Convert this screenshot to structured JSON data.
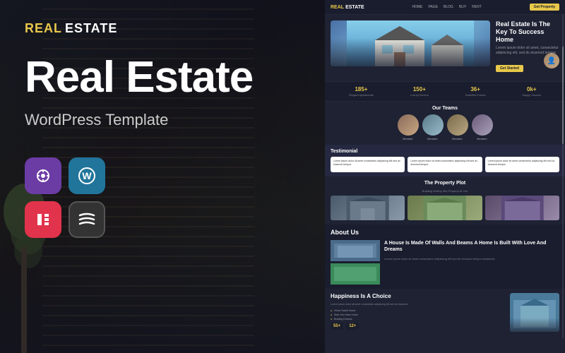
{
  "brand": {
    "real": "REAL",
    "estate": "ESTATE"
  },
  "left": {
    "heading": "Real Estate",
    "subtitle": "WordPress Template",
    "plugins": [
      {
        "name": "Quix",
        "icon": "⟳",
        "bg": "#6c3ca5"
      },
      {
        "name": "WordPress",
        "icon": "W",
        "bg": "#21759b"
      },
      {
        "name": "Elementor",
        "icon": "E",
        "bg": "#e2334c"
      },
      {
        "name": "UF",
        "icon": "≋",
        "bg": "#333"
      }
    ]
  },
  "preview": {
    "nav": {
      "logo_real": "REAL",
      "logo_estate": "ESTATE",
      "links": [
        "HOME",
        "PAGE",
        "BLOG",
        "BUY",
        "RENT"
      ],
      "cta": "Get Property"
    },
    "hero": {
      "heading": "Real Estate Is The Key To Success Home",
      "subtext": "Lorem ipsum dolor sit amet, consectetur adipiscing elit, sed do eiusmod tempor.",
      "cta": "Get Started"
    },
    "stats": [
      {
        "num": "185+",
        "label": "Elegant Apartments"
      },
      {
        "num": "150+",
        "label": "Luxury Rooms"
      },
      {
        "num": "36+",
        "label": "Satisfied Events"
      },
      {
        "num": "0k+",
        "label": "Happy Owners"
      }
    ],
    "team": {
      "title": "Our Teams",
      "members": [
        {
          "name": "Team Member"
        },
        {
          "name": "Team Member"
        },
        {
          "name": "Team Member"
        },
        {
          "name": "Team Member"
        }
      ]
    },
    "testimonial": {
      "title": "Testimonial",
      "cards": [
        {
          "text": "Lorem ipsum dolor sit amet consectetur adipiscing elit sed do eiusmod tempor."
        },
        {
          "text": "Lorem ipsum dolor sit amet consectetur adipiscing elit sed do eiusmod tempor."
        },
        {
          "text": "Lorem ipsum dolor sit amet consectetur adipiscing elit sed do eiusmod tempor."
        }
      ]
    },
    "property": {
      "title": "The Property Plot",
      "subtitle": "Building Worthy Site Property At You"
    },
    "about": {
      "title": "About Us",
      "quote": "A House Is Made Of Walls And Beams A Home Is Built With Love And Dreams",
      "desc": "Lorem ipsum dolor sit amet consectetur adipiscing elit sed do eiusmod tempor incididunt."
    },
    "happiness": {
      "title": "Happiness Is A Choice",
      "desc": "Lorem ipsum dolor sit amet consectetur adipiscing elit sed do eiusmod.",
      "list": [
        "Home Sweet Home",
        "Start Your New Home",
        "Building Dreams"
      ],
      "stats": [
        {
          "num": "55+",
          "label": "..."
        },
        {
          "num": "12+",
          "label": "..."
        }
      ]
    }
  }
}
